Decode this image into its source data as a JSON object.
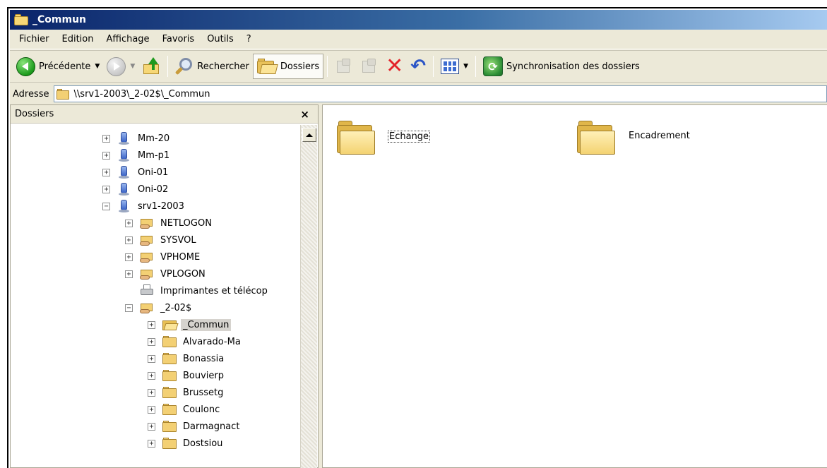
{
  "window": {
    "title": "_Commun"
  },
  "menu": [
    "Fichier",
    "Edition",
    "Affichage",
    "Favoris",
    "Outils",
    "?"
  ],
  "toolbar": {
    "back_label": "Précédente",
    "search_label": "Rechercher",
    "folders_label": "Dossiers",
    "sync_label": "Synchronisation des dossiers"
  },
  "address": {
    "label": "Adresse",
    "value": "\\\\srv1-2003\\_2-02$\\_Commun"
  },
  "folders_pane": {
    "title": "Dossiers",
    "close": "×",
    "tree": [
      {
        "label": "Mm-20",
        "expander": "+",
        "icon": "computer"
      },
      {
        "label": "Mm-p1",
        "expander": "+",
        "icon": "computer"
      },
      {
        "label": "Oni-01",
        "expander": "+",
        "icon": "computer"
      },
      {
        "label": "Oni-02",
        "expander": "+",
        "icon": "computer"
      },
      {
        "label": "srv1-2003",
        "expander": "−",
        "icon": "computer"
      },
      {
        "label": "NETLOGON",
        "expander": "+",
        "icon": "shared-folder"
      },
      {
        "label": "SYSVOL",
        "expander": "+",
        "icon": "shared-folder"
      },
      {
        "label": "VPHOME",
        "expander": "+",
        "icon": "shared-folder"
      },
      {
        "label": "VPLOGON",
        "expander": "+",
        "icon": "shared-folder"
      },
      {
        "label": "Imprimantes et télécop",
        "expander": "",
        "icon": "printer"
      },
      {
        "label": "_2-02$",
        "expander": "−",
        "icon": "shared-folder"
      },
      {
        "label": "_Commun",
        "expander": "+",
        "icon": "open-folder",
        "selected": true
      },
      {
        "label": "Alvarado-Ma",
        "expander": "+",
        "icon": "folder"
      },
      {
        "label": "Bonassia",
        "expander": "+",
        "icon": "folder"
      },
      {
        "label": "Bouvierp",
        "expander": "+",
        "icon": "folder"
      },
      {
        "label": "Brussetg",
        "expander": "+",
        "icon": "folder"
      },
      {
        "label": "Coulonc",
        "expander": "+",
        "icon": "folder"
      },
      {
        "label": "Darmagnact",
        "expander": "+",
        "icon": "folder"
      },
      {
        "label": "Dostsiou",
        "expander": "+",
        "icon": "folder"
      }
    ]
  },
  "content": {
    "items": [
      {
        "label": "Echange",
        "icon": "folder",
        "focused": true
      },
      {
        "label": "Encadrement",
        "icon": "folder",
        "focused": false
      }
    ]
  },
  "colors": {
    "title_bar_start": "#0a246a",
    "title_bar_end": "#a6caf0",
    "chrome": "#ece9d8",
    "delete_red": "#e3232a",
    "folder_yellow": "#f3d074"
  }
}
